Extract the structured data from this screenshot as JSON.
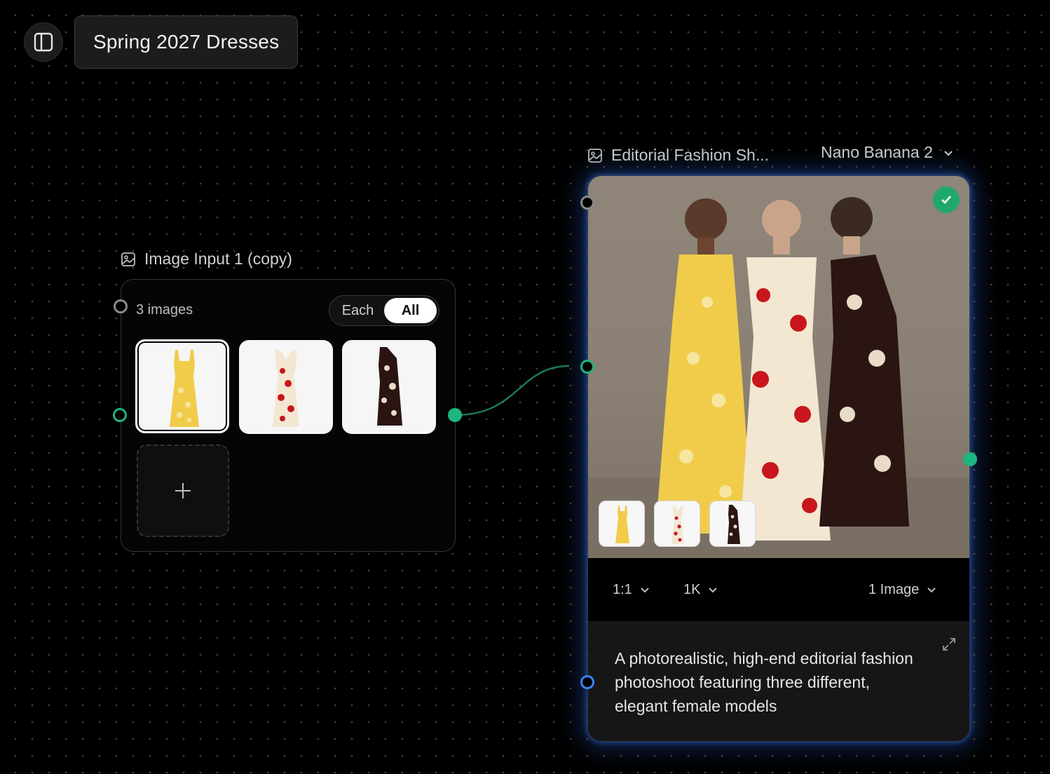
{
  "workspace": {
    "title": "Spring 2027 Dresses"
  },
  "input_node": {
    "label": "Image Input 1 (copy)",
    "count_text": "3 images",
    "mode_options": [
      "Each",
      "All"
    ],
    "mode_selected": "All",
    "images": [
      {
        "name": "yellow-floral-dress"
      },
      {
        "name": "red-floral-dress"
      },
      {
        "name": "black-floral-dress"
      }
    ]
  },
  "gen_node": {
    "label": "Editorial Fashion Sh...",
    "model": "Nano Banana 2",
    "status": "complete",
    "aspect_ratio": "1:1",
    "resolution": "1K",
    "image_count": "1 Image",
    "prompt": "A photorealistic, high-end editorial fashion photoshoot featuring three different, elegant female models"
  },
  "colors": {
    "port_green": "#1fb57f",
    "port_blue": "#3b82f6",
    "accent_glow": "#2a5bd0",
    "dress_yellow": "#f0cc4a",
    "dress_red": "#c8161c",
    "dress_black": "#2a1513"
  }
}
